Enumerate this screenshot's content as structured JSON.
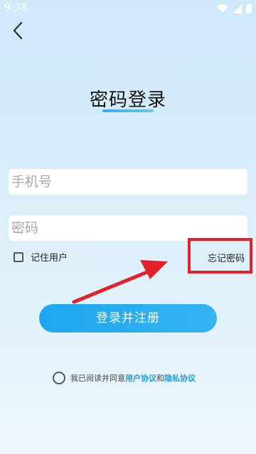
{
  "status_bar": {
    "time": "9:38"
  },
  "login": {
    "title": "密码登录",
    "phone_placeholder": "手机号",
    "password_placeholder": "密码",
    "remember_label": "记住用户",
    "forgot_password": "忘记密码",
    "submit_label": "登录并注册"
  },
  "agreement": {
    "prefix": "我已阅读并同意",
    "user_agreement": "用户协议",
    "and": "和",
    "privacy_policy": "隐私协议"
  },
  "colors": {
    "accent": "#1ea6ee",
    "link": "#1d9de4",
    "annotation_red": "#e3212b"
  },
  "icons": [
    "back-arrow-icon",
    "wifi-icon",
    "signal-icon",
    "battery-icon",
    "annotation-arrow-icon"
  ]
}
